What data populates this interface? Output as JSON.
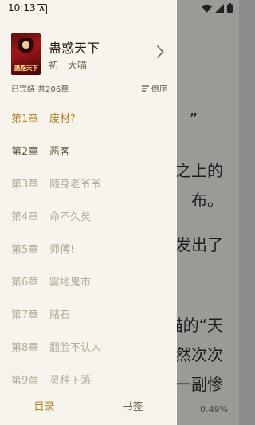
{
  "status_bar": {
    "time": "10:13",
    "notification_icon": "A"
  },
  "reader": {
    "lines": [
      "”",
      "之上的",
      "布。",
      "发出了",
      "喵的“天",
      "然次次",
      "一副惨"
    ],
    "progress": "0.49%"
  },
  "book": {
    "cover_text": "蛊惑天下",
    "title": "蛊惑天下",
    "author": "初一大喵",
    "status": "已完结 共206章",
    "sort_label": "倒序"
  },
  "chapters": [
    {
      "number": "第1章",
      "title": "废材?",
      "state": "current"
    },
    {
      "number": "第2章",
      "title": "恶客",
      "state": "read"
    },
    {
      "number": "第3章",
      "title": "随身老爷爷",
      "state": "unread"
    },
    {
      "number": "第4章",
      "title": "命不久矣",
      "state": "unread"
    },
    {
      "number": "第5章",
      "title": "师傅!",
      "state": "unread"
    },
    {
      "number": "第6章",
      "title": "雾地鬼市",
      "state": "unread"
    },
    {
      "number": "第7章",
      "title": "赌石",
      "state": "unread"
    },
    {
      "number": "第8章",
      "title": "翻脸不认人",
      "state": "unread"
    },
    {
      "number": "第9章",
      "title": "灵种下落",
      "state": "unread"
    }
  ],
  "tabs": {
    "contents": "目录",
    "bookmarks": "书签"
  },
  "colors": {
    "accent": "#b5822c",
    "drawer_bg": "#f7f4ec"
  }
}
